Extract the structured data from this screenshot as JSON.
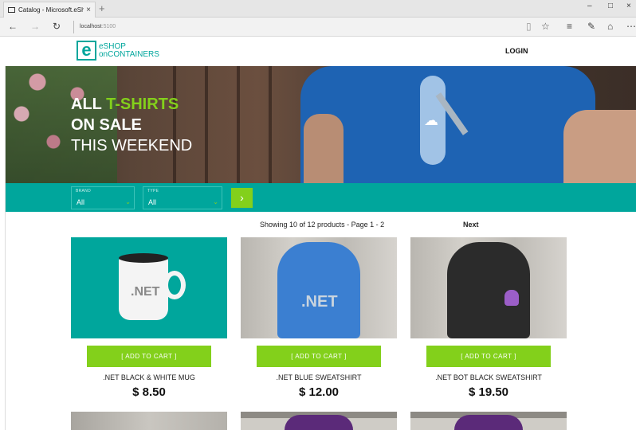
{
  "browser": {
    "tab_title": "Catalog - Microsoft.eSh",
    "close_glyph": "×",
    "new_tab_glyph": "+",
    "address_host": "localhost",
    "address_port": ":5100",
    "minimize_glyph": "–",
    "maximize_glyph": "□",
    "close_window_glyph": "×"
  },
  "header": {
    "logo_letter": "e",
    "logo_line1": "eSHOP",
    "logo_line2": "onCONTAINERS",
    "login_label": "LOGIN"
  },
  "hero": {
    "line1_a": "ALL",
    "line1_b": "T-SHIRTS",
    "line2": "ON SALE",
    "line3": "THIS WEEKEND"
  },
  "filters": {
    "brand_label": "BRAND",
    "brand_value": "All",
    "type_label": "TYPE",
    "type_value": "All",
    "go_glyph": "›"
  },
  "pager": {
    "text": "Showing 10 of 12 products - Page 1 - 2",
    "next_label": "Next"
  },
  "products": [
    {
      "name": ".NET BLACK & WHITE MUG",
      "price": "$ 8.50",
      "cart_label": "[ ADD TO CART ]",
      "image_text": ".NET"
    },
    {
      "name": ".NET BLUE SWEATSHIRT",
      "price": "$ 12.00",
      "cart_label": "[ ADD TO CART ]",
      "image_text": ".NET"
    },
    {
      "name": ".NET BOT BLACK SWEATSHIRT",
      "price": "$ 19.50",
      "cart_label": "[ ADD TO CART ]"
    }
  ],
  "colors": {
    "brand_teal": "#00a69c",
    "accent_green": "#83d01b"
  }
}
